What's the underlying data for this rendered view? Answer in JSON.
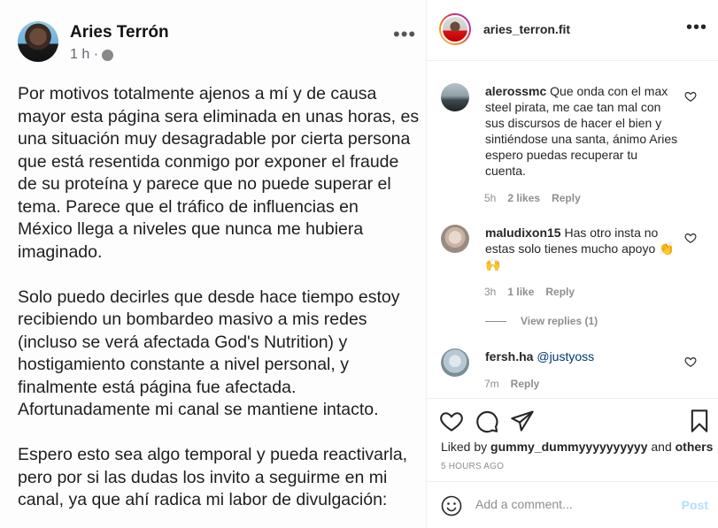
{
  "post_image": {
    "author": "Aries Terrón",
    "time": "1 h ·",
    "paragraphs": [
      "Por motivos totalmente ajenos a mí y de causa\nmayor esta página sera eliminada en unas horas, es\nuna situación muy desagradable por cierta persona\nque está resentida conmigo por exponer el fraude\nde su proteína y parece que no puede superar el\ntema. Parece que el tráfico de influencias en\nMéxico llega a niveles que nunca me hubiera\nimaginado.",
      "Solo puedo decirles que desde hace tiempo estoy\nrecibiendo un bombardeo masivo a mis redes\n(incluso se verá afectada God's Nutrition) y\nhostigamiento constante a nivel personal, y\nfinalmente está página fue afectada.\nAfortunadamente mi canal se mantiene intacto.",
      "Espero esto sea algo temporal y pueda reactivarla,\npero por si las dudas los invito a seguirme en mi\ncanal, ya que ahí radica mi labor de divulgación:"
    ]
  },
  "header": {
    "username": "aries_terron.fit",
    "more": "•••"
  },
  "comments": [
    {
      "username": "alerossmc",
      "text": "Que onda con el max steel pirata, me cae tan mal con sus discursos de hacer el bien y sintiéndose una santa, ánimo Aries espero puedas recuperar tu cuenta.",
      "time": "5h",
      "likes": "2 likes",
      "reply": "Reply"
    },
    {
      "username": "maludixon15",
      "text": "Has otro insta no estas solo tienes mucho apoyo 👏🙌",
      "time": "3h",
      "likes": "1 like",
      "reply": "Reply",
      "view_replies": "View replies (1)"
    },
    {
      "username": "fersh.ha",
      "mention": "@justyoss",
      "time": "7m",
      "reply": "Reply"
    }
  ],
  "likes": {
    "prefix": "Liked by",
    "user": "gummy_dummyyyyyyyyyy",
    "joiner": "and",
    "others": "others"
  },
  "timestamp": "5 HOURS AGO",
  "add_comment": {
    "placeholder": "Add a comment...",
    "post_label": "Post"
  },
  "colors": {
    "link": "#00376b",
    "post_disabled": "#b2dffc",
    "muted": "#8e8e8e"
  }
}
